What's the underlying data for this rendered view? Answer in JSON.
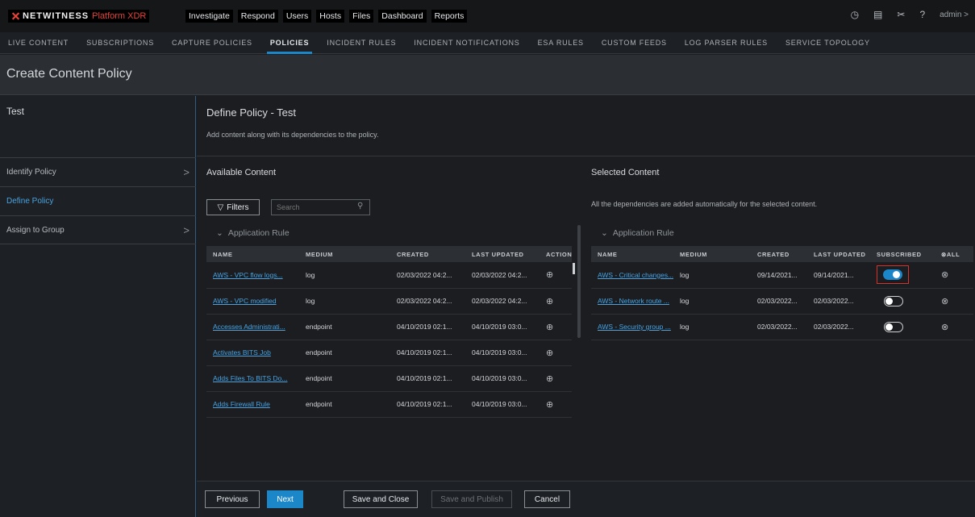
{
  "brand": {
    "name": "NETWITNESS",
    "product": "Platform XDR"
  },
  "topnav": [
    "Investigate",
    "Respond",
    "Users",
    "Hosts",
    "Files",
    "Dashboard",
    "Reports"
  ],
  "topright": {
    "user": "admin >"
  },
  "subnav": [
    {
      "label": "LIVE CONTENT",
      "active": false
    },
    {
      "label": "SUBSCRIPTIONS",
      "active": false
    },
    {
      "label": "CAPTURE POLICIES",
      "active": false
    },
    {
      "label": "POLICIES",
      "active": true
    },
    {
      "label": "INCIDENT RULES",
      "active": false
    },
    {
      "label": "INCIDENT NOTIFICATIONS",
      "active": false
    },
    {
      "label": "ESA RULES",
      "active": false
    },
    {
      "label": "CUSTOM FEEDS",
      "active": false
    },
    {
      "label": "LOG PARSER RULES",
      "active": false
    },
    {
      "label": "SERVICE TOPOLOGY",
      "active": false
    }
  ],
  "page_title": "Create Content Policy",
  "left": {
    "policy_name": "Test",
    "steps": [
      {
        "label": "Identify Policy",
        "chevron": ">"
      },
      {
        "label": "Define Policy",
        "chevron": ""
      },
      {
        "label": "Assign to Group",
        "chevron": ">"
      }
    ]
  },
  "main": {
    "title": "Define Policy - Test",
    "subtitle": "Add content along with its dependencies to the policy.",
    "available": {
      "title": "Available Content",
      "filters_label": "Filters",
      "search_placeholder": "Search",
      "group": "Application Rule",
      "columns": [
        "NAME",
        "MEDIUM",
        "CREATED",
        "LAST UPDATED",
        "ACTION"
      ],
      "rows": [
        {
          "name": "AWS - VPC flow logs...",
          "medium": "log",
          "created": "02/03/2022 04:2...",
          "updated": "02/03/2022 04:2...",
          "action": "⊕"
        },
        {
          "name": "AWS - VPC modified",
          "medium": "log",
          "created": "02/03/2022 04:2...",
          "updated": "02/03/2022 04:2...",
          "action": "⊕"
        },
        {
          "name": "Accesses Administrati...",
          "medium": "endpoint",
          "created": "04/10/2019 02:1...",
          "updated": "04/10/2019 03:0...",
          "action": "⊕"
        },
        {
          "name": "Activates BITS Job",
          "medium": "endpoint",
          "created": "04/10/2019 02:1...",
          "updated": "04/10/2019 03:0...",
          "action": "⊕"
        },
        {
          "name": "Adds Files To BITS Do...",
          "medium": "endpoint",
          "created": "04/10/2019 02:1...",
          "updated": "04/10/2019 03:0...",
          "action": "⊕"
        },
        {
          "name": "Adds Firewall Rule",
          "medium": "endpoint",
          "created": "04/10/2019 02:1...",
          "updated": "04/10/2019 03:0...",
          "action": "⊕"
        }
      ]
    },
    "selected": {
      "title": "Selected Content",
      "note": "All the dependencies are added automatically for the selected content.",
      "group": "Application Rule",
      "columns": [
        "NAME",
        "MEDIUM",
        "CREATED",
        "LAST UPDATED",
        "SUBSCRIBED",
        "ALL"
      ],
      "rows": [
        {
          "name": "AWS - Critical changes...",
          "medium": "log",
          "created": "09/14/2021...",
          "updated": "09/14/2021...",
          "subscribed": true,
          "remove": "⊗"
        },
        {
          "name": "AWS - Network route ...",
          "medium": "log",
          "created": "02/03/2022...",
          "updated": "02/03/2022...",
          "subscribed": false,
          "remove": "⊗"
        },
        {
          "name": "AWS - Security group ...",
          "medium": "log",
          "created": "02/03/2022...",
          "updated": "02/03/2022...",
          "subscribed": false,
          "remove": "⊗"
        }
      ]
    }
  },
  "footer": {
    "previous": "Previous",
    "next": "Next",
    "save_close": "Save and Close",
    "save_publish": "Save and Publish",
    "cancel": "Cancel"
  },
  "colors": {
    "accent": "#1b87c9",
    "link": "#4aa3e0",
    "brand_red": "#e5423a",
    "highlight": "#d2332d"
  }
}
